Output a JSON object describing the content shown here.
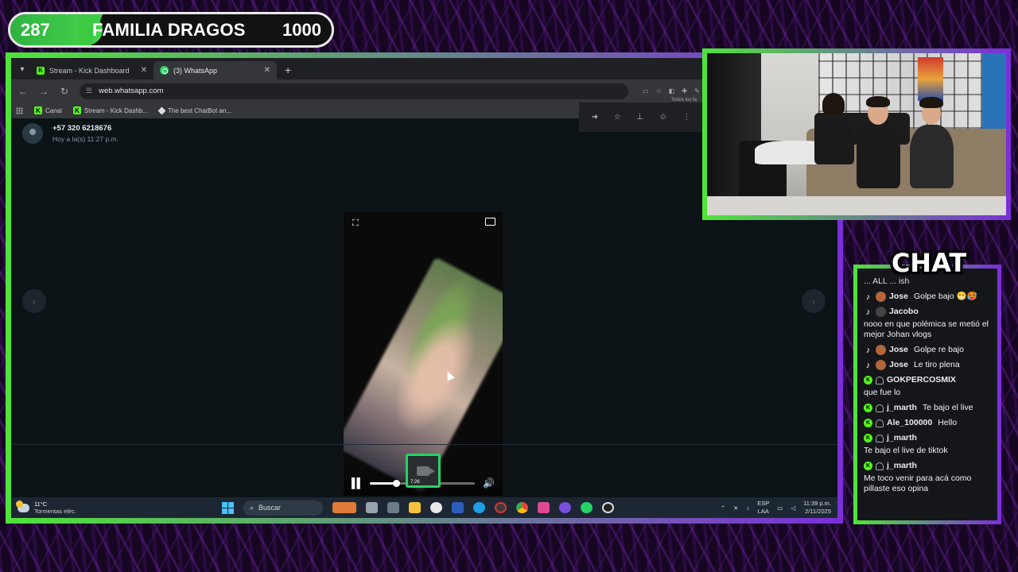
{
  "goal": {
    "current": "287",
    "name": "FAMILIA DRAGOS",
    "target": "1000",
    "progress_fraction": 0.287
  },
  "browser": {
    "tabs": [
      {
        "label": "Stream - Kick Dashboard",
        "icon": "kick-icon",
        "active": false
      },
      {
        "label": "(3) WhatsApp",
        "icon": "whatsapp-icon",
        "active": true
      }
    ],
    "url": "web.whatsapp.com",
    "bookmarks": [
      {
        "label": "Canal",
        "icon": "kick-icon"
      },
      {
        "label": "Stream - Kick Dashb...",
        "icon": "kick-icon"
      },
      {
        "label": "The best ChatBot an...",
        "icon": "diamond-icon"
      }
    ],
    "all_bookmarks_label": "Todos los fa"
  },
  "whatsapp": {
    "contact_number": "+57 320 6218676",
    "contact_time": "Hoy a la(s) 11:27 p.m.",
    "thumbnail_duration": "7:26",
    "video_progress_fraction": 0.25
  },
  "taskbar": {
    "temperature": "11°C",
    "weather_desc": "Tormentas eléc.",
    "search_placeholder": "Buscar",
    "lang_1": "ESP",
    "lang_2": "LAA",
    "time": "11:39 p.m.",
    "date": "2/11/2025"
  },
  "chat": {
    "title": "CHAT",
    "cut_message": "... ALL ... ish",
    "messages": [
      {
        "platform": "tiktok",
        "user": "Jose",
        "text": "Golpe bajo 😁🥵",
        "inline": true
      },
      {
        "platform": "tiktok",
        "user": "Jacobo",
        "text": "nooo en que polémica se metió el mejor Johan vlogs",
        "inline": false
      },
      {
        "platform": "tiktok",
        "user": "Jose",
        "text": "Golpe re bajo",
        "inline": true
      },
      {
        "platform": "tiktok",
        "user": "Jose",
        "text": "Le tiro plena",
        "inline": true
      },
      {
        "platform": "kick",
        "user": "GOKPERCOSMIX",
        "text": "que fue lo",
        "inline": false
      },
      {
        "platform": "kick",
        "user": "j_marth",
        "text": "Te bajo el live",
        "inline": true
      },
      {
        "platform": "kick",
        "user": "Ale_100000",
        "text": "Hello",
        "inline": true
      },
      {
        "platform": "kick",
        "user": "j_marth",
        "text": "Te bajo el live de tiktok",
        "inline": false
      },
      {
        "platform": "kick",
        "user": "j_marth",
        "text": "Me toco venir para acá como pillaste eso opina",
        "inline": false
      }
    ]
  }
}
